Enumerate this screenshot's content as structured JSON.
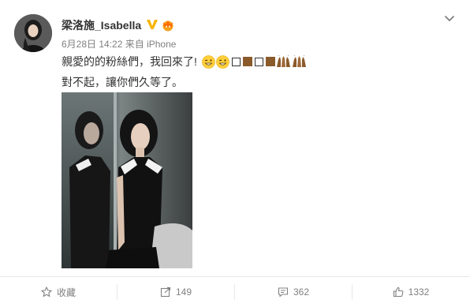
{
  "user": {
    "name": "梁洛施_Isabella",
    "badge_icon": "verified-v-icon",
    "crown_icon": "vip-crown-icon",
    "badge_color": "#f5b400"
  },
  "meta": {
    "date": "6月28日 14:22",
    "source": "来自 iPhone"
  },
  "post": {
    "line1": "親愛的的粉絲們，我回來了!",
    "line2": "對不起，讓你們久等了。",
    "emoji_names": [
      "grinning-wink-emoji",
      "grinning-wink-emoji",
      "empty-box-glyph",
      "brown-box-glyph",
      "empty-box-glyph",
      "brown-box-glyph",
      "praying-hands-emoji",
      "praying-hands-emoji"
    ]
  },
  "actions": {
    "favorite_label": "收藏",
    "repost_count": "149",
    "comment_count": "362",
    "like_count": "1332"
  },
  "colors": {
    "text": "#333333",
    "muted": "#808080",
    "divider": "#e8e8e8"
  }
}
